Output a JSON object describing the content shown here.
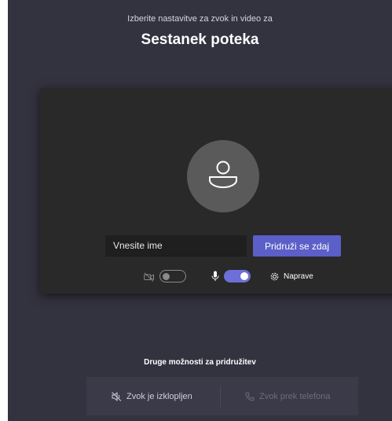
{
  "header": {
    "subtitle": "Izberite nastavitve za zvok in video za",
    "title": "Sestanek poteka"
  },
  "preview": {
    "name_placeholder": "Vnesite ime",
    "join_button_label": "Pridruži se zdaj"
  },
  "controls": {
    "camera": {
      "icon": "camera-off-icon",
      "enabled": false
    },
    "microphone": {
      "icon": "microphone-icon",
      "enabled": true
    },
    "devices_label": "Naprave",
    "devices_icon": "gear-icon"
  },
  "other_options": {
    "heading": "Druge možnosti za pridružitev",
    "audio_off_label": "Zvok je izklopljen",
    "phone_audio_label": "Zvok prek telefona"
  },
  "colors": {
    "background": "#33323f",
    "card": "#292929",
    "accent": "#5b5fc7",
    "toggle_on": "#6b6fd6"
  }
}
